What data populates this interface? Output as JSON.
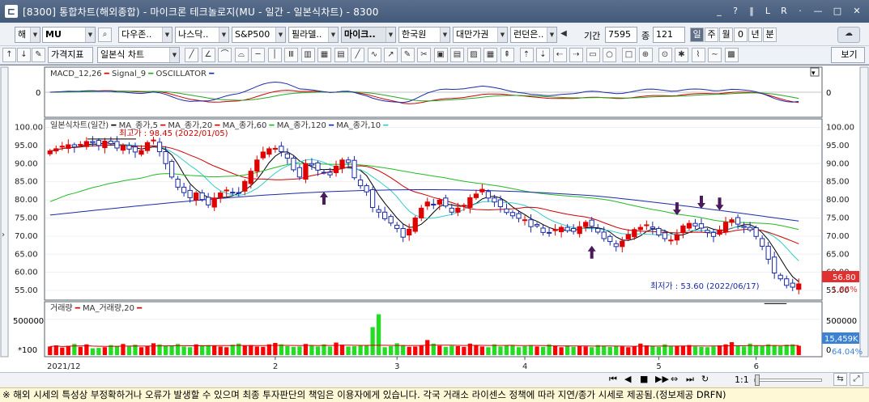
{
  "window": {
    "title": "[8300] 통합차트(해외종합) - 마이크론 테크놀로지(MU - 일간 - 일본식차트) - 8300",
    "icon": "chart-app-icon",
    "buttons": [
      "_",
      "?",
      "‖",
      "L",
      "R",
      "·",
      "—",
      "□",
      "✕"
    ]
  },
  "toolbar": {
    "market_select": "해",
    "symbol_input": "MU",
    "search_icon": "search-icon",
    "symbol_tabs": [
      "다우존..",
      "나스닥..",
      "S&P500",
      "필라델..",
      "마이크..",
      "한국원",
      "대만가권",
      "런던은.."
    ],
    "active_symbol_tab": "마이크..",
    "period_label": "기간",
    "period_value": "7595",
    "count_label": "종",
    "count_value": "121",
    "period_buttons": [
      "일",
      "주",
      "월",
      "0",
      "년",
      "분"
    ],
    "active_period": "일",
    "price_indicator_label": "가격지표",
    "chart_type_select": "일본식 차트",
    "view_button": "보기"
  },
  "chart": {
    "macd_legend": [
      "MACD_12,26",
      "Signal_9",
      "OSCILLATOR"
    ],
    "macd_axis_label": "0",
    "price_legend_title": "일본식차트(일간)",
    "price_legend_items": [
      {
        "name": "MA_종가,5",
        "color": "#000000"
      },
      {
        "name": "MA_종가,20",
        "color": "#d00000"
      },
      {
        "name": "MA_종가,60",
        "color": "#22bb22"
      },
      {
        "name": "MA_종가,120",
        "color": "#1a2aa8"
      },
      {
        "name": "MA_종가,10",
        "color": "#33cccc"
      }
    ],
    "high_annotation": "최고가 : 98.45 (2022/01/05)",
    "low_annotation": "최저가 : 53.60 (2022/06/17)",
    "price_ticks": [
      "100.00",
      "95.00",
      "90.00",
      "85.00",
      "80.00",
      "75.00",
      "70.00",
      "65.00",
      "60.00",
      "55.00"
    ],
    "current_price": "56.80",
    "change_pct": "1.88%",
    "volume_legend": [
      "거래량",
      "MA_거래량,20"
    ],
    "volume_ticks": [
      "500000",
      "0"
    ],
    "volume_unit": "*100",
    "current_volume": "15,459K",
    "volume_pct": "64.04%",
    "x_labels": [
      "2021/12",
      "2",
      "3",
      "4",
      "5",
      "6"
    ]
  },
  "statusbar": {
    "controls": [
      "⏮",
      "◀",
      "■",
      "▶▶",
      "⇔",
      "⏭",
      "↻"
    ],
    "zoom_label": "1:1",
    "icons": [
      "fit-icon",
      "expand-icon"
    ]
  },
  "notice": "※ 해외 시세의 특성상 부정확하거나 오류가 발생할 수 있으며 최종 투자판단의 책임은 이용자에게 있습니다. 각국 거래소 라이센스 정책에 따라 지연/종가 시세로 제공됨.(정보제공 DRFN)",
  "chart_data": {
    "type": "candlestick",
    "title": "일본식차트(일간)",
    "symbol": "MU",
    "ylim": [
      53,
      101
    ],
    "y_ticks": [
      100,
      95,
      90,
      85,
      80,
      75,
      70,
      65,
      60,
      55
    ],
    "x_labels": [
      "2021/12",
      "2",
      "3",
      "4",
      "5",
      "6"
    ],
    "high": {
      "value": 98.45,
      "date": "2022/01/05"
    },
    "low": {
      "value": 53.6,
      "date": "2022/06/17"
    },
    "last_close": 56.8,
    "closes": [
      93.5,
      94.1,
      94.8,
      95.2,
      94.6,
      95.3,
      96.1,
      95.8,
      95.0,
      96.2,
      95.5,
      94.3,
      95.0,
      94.0,
      93.2,
      93.6,
      95.8,
      96.5,
      93.3,
      90.0,
      86.3,
      83.5,
      82.0,
      80.6,
      81.9,
      80.1,
      78.6,
      80.5,
      81.9,
      82.7,
      82.0,
      81.8,
      85.1,
      87.9,
      91.0,
      93.2,
      94.1,
      94.2,
      93.3,
      91.5,
      88.3,
      86.3,
      90.0,
      89.6,
      88.2,
      87.6,
      86.9,
      89.3,
      91.0,
      90.3,
      86.1,
      83.9,
      82.2,
      77.9,
      76.6,
      74.8,
      73.6,
      72.1,
      69.7,
      71.9,
      75.0,
      77.7,
      79.4,
      78.8,
      79.9,
      78.3,
      76.6,
      77.7,
      78.5,
      80.6,
      81.6,
      82.9,
      80.5,
      79.4,
      78.1,
      76.5,
      75.6,
      74.9,
      74.5,
      72.6,
      72.8,
      71.0,
      70.9,
      71.8,
      72.4,
      71.5,
      71.3,
      72.6,
      73.8,
      72.7,
      71.1,
      69.3,
      68.5,
      67.1,
      68.6,
      70.4,
      71.8,
      72.4,
      73.1,
      72.1,
      70.3,
      69.3,
      68.9,
      70.4,
      72.8,
      73.5,
      72.8,
      72.2,
      71.0,
      69.9,
      71.7,
      73.8,
      74.5,
      73.3,
      72.4,
      71.7,
      69.9,
      67.2,
      63.6,
      59.8,
      58.2,
      56.4,
      55.9,
      56.8
    ],
    "volume_ylim": [
      0,
      700000
    ],
    "volume_ticks": [
      500000,
      0
    ],
    "volume_unit": "*100",
    "last_volume_display": "15,459K",
    "volume_pct": 64.04,
    "volume": [
      120000,
      135000,
      105000,
      130000,
      155000,
      115000,
      150000,
      95000,
      100000,
      110000,
      140000,
      125000,
      155000,
      120000,
      145000,
      110000,
      130000,
      165000,
      150000,
      125000,
      130000,
      155000,
      120000,
      110000,
      150000,
      125000,
      140000,
      135000,
      120000,
      110000,
      145000,
      160000,
      130000,
      140000,
      120000,
      115000,
      150000,
      170000,
      150000,
      125000,
      115000,
      120000,
      155000,
      130000,
      120000,
      150000,
      120000,
      175000,
      145000,
      120000,
      125000,
      140000,
      130000,
      155000,
      120000,
      110000,
      125000,
      165000,
      140000,
      115000,
      120000,
      130000,
      210000,
      160000,
      130000,
      115000,
      130000,
      125000,
      115000,
      160000,
      135000,
      120000,
      110000,
      150000,
      120000,
      135000,
      140000,
      110000,
      125000,
      140000,
      120000,
      115000,
      150000,
      130000,
      110000,
      125000,
      115000,
      130000,
      120000,
      110000,
      140000,
      125000,
      115000,
      130000,
      120000,
      110000,
      120000,
      160000,
      135000,
      125000,
      115000,
      150000,
      120000,
      130000,
      125000,
      140000,
      120000,
      115000,
      110000,
      120000,
      135000,
      150000,
      180000,
      125000,
      120000,
      160000,
      130000,
      125000,
      150000,
      140000,
      125000,
      145000,
      150000,
      130000
    ],
    "volume_highlight": {
      "index": 54,
      "value": 570000
    },
    "volume_spike_2": {
      "index": 53,
      "value": 390000
    },
    "markers_up": [
      45,
      89
    ],
    "markers_down": [
      103,
      107,
      110
    ]
  }
}
